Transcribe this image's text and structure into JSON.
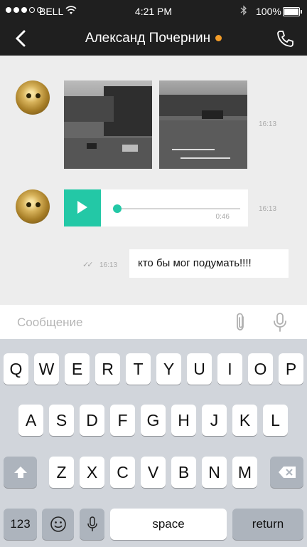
{
  "status_bar": {
    "carrier": "BELL",
    "time": "4:21 PM",
    "battery_percent": "100%"
  },
  "nav": {
    "title": "Александ Почернин",
    "online_color": "#f39c28"
  },
  "messages": {
    "photos_time": "16:13",
    "audio": {
      "duration": "0:46",
      "time": "16:13",
      "progress": 0
    },
    "outgoing": {
      "text": "кто бы мог подумать!!!!",
      "time": "16:13"
    }
  },
  "composer": {
    "placeholder": "Сообщение"
  },
  "keyboard": {
    "row1": [
      "Q",
      "W",
      "E",
      "R",
      "T",
      "Y",
      "U",
      "I",
      "O",
      "P"
    ],
    "row2": [
      "A",
      "S",
      "D",
      "F",
      "G",
      "H",
      "J",
      "K",
      "L"
    ],
    "row3": [
      "Z",
      "X",
      "C",
      "V",
      "B",
      "N",
      "M"
    ],
    "numbers_label": "123",
    "space_label": "space",
    "return_label": "return"
  },
  "colors": {
    "accent": "#23c8a6",
    "header": "#1f1f1f",
    "chat_bg": "#ededed"
  }
}
